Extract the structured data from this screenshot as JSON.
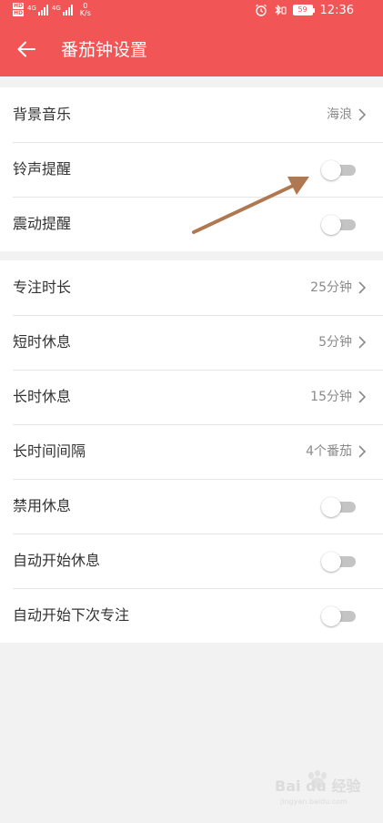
{
  "status_bar": {
    "sim1_tag_top": "HD",
    "sim1_tag_bottom": "HD",
    "sim1_net": "4G",
    "sim2_net": "4G",
    "net_speed_value": "0",
    "net_speed_unit": "K/s",
    "battery_level": "59",
    "time": "12:36"
  },
  "header": {
    "title": "番茄钟设置",
    "back_icon": "arrow-left-icon",
    "background_color": "#f25555"
  },
  "groups": [
    {
      "rows": [
        {
          "label": "背景音乐",
          "type": "select",
          "value": "海浪"
        },
        {
          "label": "铃声提醒",
          "type": "toggle",
          "on": false
        },
        {
          "label": "震动提醒",
          "type": "toggle",
          "on": false
        }
      ]
    },
    {
      "rows": [
        {
          "label": "专注时长",
          "type": "select",
          "value": "25分钟"
        },
        {
          "label": "短时休息",
          "type": "select",
          "value": "5分钟"
        },
        {
          "label": "长时休息",
          "type": "select",
          "value": "15分钟"
        },
        {
          "label": "长时间间隔",
          "type": "select",
          "value": "4个番茄"
        },
        {
          "label": "禁用休息",
          "type": "toggle",
          "on": false
        },
        {
          "label": "自动开始休息",
          "type": "toggle",
          "on": false
        },
        {
          "label": "自动开始下次专注",
          "type": "toggle",
          "on": false
        }
      ]
    }
  ],
  "annotation": {
    "arrow_color": "#b07850"
  },
  "watermark": {
    "brand": "Bai du 经验",
    "domain": "jingyan.baidu.com"
  }
}
